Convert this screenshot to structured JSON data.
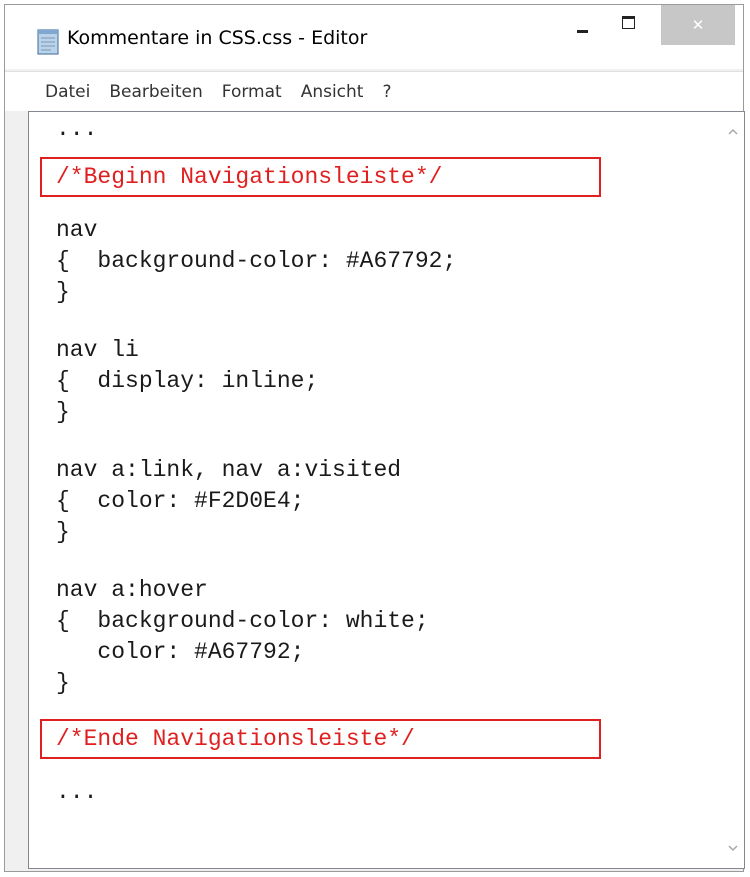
{
  "window": {
    "title": "Kommentare in CSS.css - Editor",
    "close_glyph": "✕"
  },
  "menu": {
    "items": [
      "Datei",
      "Bearbeiten",
      "Format",
      "Ansicht",
      "?"
    ]
  },
  "editor": {
    "lines": [
      "...",
      "/*Beginn Navigationsleiste*/",
      "nav",
      "{  background-color: #A67792;",
      "}",
      "nav li",
      "{  display: inline;",
      "}",
      "nav a:link, nav a:visited",
      "{  color: #F2D0E4;",
      "}",
      "nav a:hover",
      "{  background-color: white;",
      "   color: #A67792;",
      "}",
      "/*Ende Navigationsleiste*/",
      "..."
    ]
  },
  "colors": {
    "comment": "#e02020",
    "code": "#1a1a1a",
    "close_button_bg": "#c7c7c7"
  },
  "icons": {
    "app": "notepad-icon",
    "minimize": "minimize-icon",
    "maximize": "maximize-icon",
    "close": "close-icon",
    "scroll_up": "chevron-up-icon",
    "scroll_down": "chevron-down-icon"
  }
}
